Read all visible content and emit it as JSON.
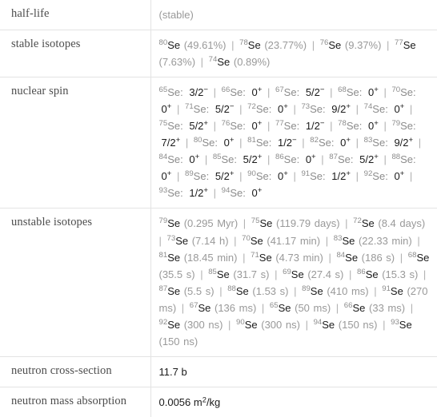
{
  "table": {
    "rows": [
      {
        "label": "half-life",
        "kind": "plain",
        "value": "(stable)"
      },
      {
        "label": "stable isotopes",
        "kind": "isotopes_abundance"
      },
      {
        "label": "nuclear spin",
        "kind": "spins"
      },
      {
        "label": "unstable isotopes",
        "kind": "isotopes_halflife"
      },
      {
        "label": "neutron cross-section",
        "kind": "plain_dark",
        "value": "11.7 b"
      },
      {
        "label": "neutron mass absorption",
        "kind": "unit_sup",
        "value": "0.0056",
        "unit_base": "m",
        "unit_sup": "2",
        "unit_tail": "/kg"
      }
    ]
  },
  "stable_isotopes": {
    "separator": "|",
    "items": [
      {
        "mass": "80",
        "element": "Se",
        "detail": "(49.61%)"
      },
      {
        "mass": "78",
        "element": "Se",
        "detail": "(23.77%)"
      },
      {
        "mass": "76",
        "element": "Se",
        "detail": "(9.37%)"
      },
      {
        "mass": "77",
        "element": "Se",
        "detail": "(7.63%)"
      },
      {
        "mass": "74",
        "element": "Se",
        "detail": "(0.89%)"
      }
    ]
  },
  "nuclear_spin": {
    "separator": "|",
    "items": [
      {
        "mass": "65",
        "element": "Se",
        "spin": "3/2",
        "sign": "−"
      },
      {
        "mass": "66",
        "element": "Se",
        "spin": "0",
        "sign": "+"
      },
      {
        "mass": "67",
        "element": "Se",
        "spin": "5/2",
        "sign": "−"
      },
      {
        "mass": "68",
        "element": "Se",
        "spin": "0",
        "sign": "+"
      },
      {
        "mass": "70",
        "element": "Se",
        "spin": "0",
        "sign": "+"
      },
      {
        "mass": "71",
        "element": "Se",
        "spin": "5/2",
        "sign": "−"
      },
      {
        "mass": "72",
        "element": "Se",
        "spin": "0",
        "sign": "+"
      },
      {
        "mass": "73",
        "element": "Se",
        "spin": "9/2",
        "sign": "+"
      },
      {
        "mass": "74",
        "element": "Se",
        "spin": "0",
        "sign": "+"
      },
      {
        "mass": "75",
        "element": "Se",
        "spin": "5/2",
        "sign": "+"
      },
      {
        "mass": "76",
        "element": "Se",
        "spin": "0",
        "sign": "+"
      },
      {
        "mass": "77",
        "element": "Se",
        "spin": "1/2",
        "sign": "−"
      },
      {
        "mass": "78",
        "element": "Se",
        "spin": "0",
        "sign": "+"
      },
      {
        "mass": "79",
        "element": "Se",
        "spin": "7/2",
        "sign": "+"
      },
      {
        "mass": "80",
        "element": "Se",
        "spin": "0",
        "sign": "+"
      },
      {
        "mass": "81",
        "element": "Se",
        "spin": "1/2",
        "sign": "−"
      },
      {
        "mass": "82",
        "element": "Se",
        "spin": "0",
        "sign": "+"
      },
      {
        "mass": "83",
        "element": "Se",
        "spin": "9/2",
        "sign": "+"
      },
      {
        "mass": "84",
        "element": "Se",
        "spin": "0",
        "sign": "+"
      },
      {
        "mass": "85",
        "element": "Se",
        "spin": "5/2",
        "sign": "+"
      },
      {
        "mass": "86",
        "element": "Se",
        "spin": "0",
        "sign": "+"
      },
      {
        "mass": "87",
        "element": "Se",
        "spin": "5/2",
        "sign": "+"
      },
      {
        "mass": "88",
        "element": "Se",
        "spin": "0",
        "sign": "+"
      },
      {
        "mass": "89",
        "element": "Se",
        "spin": "5/2",
        "sign": "+"
      },
      {
        "mass": "90",
        "element": "Se",
        "spin": "0",
        "sign": "+"
      },
      {
        "mass": "91",
        "element": "Se",
        "spin": "1/2",
        "sign": "+"
      },
      {
        "mass": "92",
        "element": "Se",
        "spin": "0",
        "sign": "+"
      },
      {
        "mass": "93",
        "element": "Se",
        "spin": "1/2",
        "sign": "+"
      },
      {
        "mass": "94",
        "element": "Se",
        "spin": "0",
        "sign": "+"
      }
    ]
  },
  "unstable_isotopes": {
    "separator": "|",
    "items": [
      {
        "mass": "79",
        "element": "Se",
        "detail": "(0.295 Myr)"
      },
      {
        "mass": "75",
        "element": "Se",
        "detail": "(119.79 days)"
      },
      {
        "mass": "72",
        "element": "Se",
        "detail": "(8.4 days)"
      },
      {
        "mass": "73",
        "element": "Se",
        "detail": "(7.14 h)"
      },
      {
        "mass": "70",
        "element": "Se",
        "detail": "(41.17 min)"
      },
      {
        "mass": "83",
        "element": "Se",
        "detail": "(22.33 min)"
      },
      {
        "mass": "81",
        "element": "Se",
        "detail": "(18.45 min)"
      },
      {
        "mass": "71",
        "element": "Se",
        "detail": "(4.73 min)"
      },
      {
        "mass": "84",
        "element": "Se",
        "detail": "(186 s)"
      },
      {
        "mass": "68",
        "element": "Se",
        "detail": "(35.5 s)"
      },
      {
        "mass": "85",
        "element": "Se",
        "detail": "(31.7 s)"
      },
      {
        "mass": "69",
        "element": "Se",
        "detail": "(27.4 s)"
      },
      {
        "mass": "86",
        "element": "Se",
        "detail": "(15.3 s)"
      },
      {
        "mass": "87",
        "element": "Se",
        "detail": "(5.5 s)"
      },
      {
        "mass": "88",
        "element": "Se",
        "detail": "(1.53 s)"
      },
      {
        "mass": "89",
        "element": "Se",
        "detail": "(410 ms)"
      },
      {
        "mass": "91",
        "element": "Se",
        "detail": "(270 ms)"
      },
      {
        "mass": "67",
        "element": "Se",
        "detail": "(136 ms)"
      },
      {
        "mass": "65",
        "element": "Se",
        "detail": "(50 ms)"
      },
      {
        "mass": "66",
        "element": "Se",
        "detail": "(33 ms)"
      },
      {
        "mass": "92",
        "element": "Se",
        "detail": "(300 ns)"
      },
      {
        "mass": "90",
        "element": "Se",
        "detail": "(300 ns)"
      },
      {
        "mass": "94",
        "element": "Se",
        "detail": "(150 ns)"
      },
      {
        "mass": "93",
        "element": "Se",
        "detail": "(150 ns)"
      }
    ]
  }
}
